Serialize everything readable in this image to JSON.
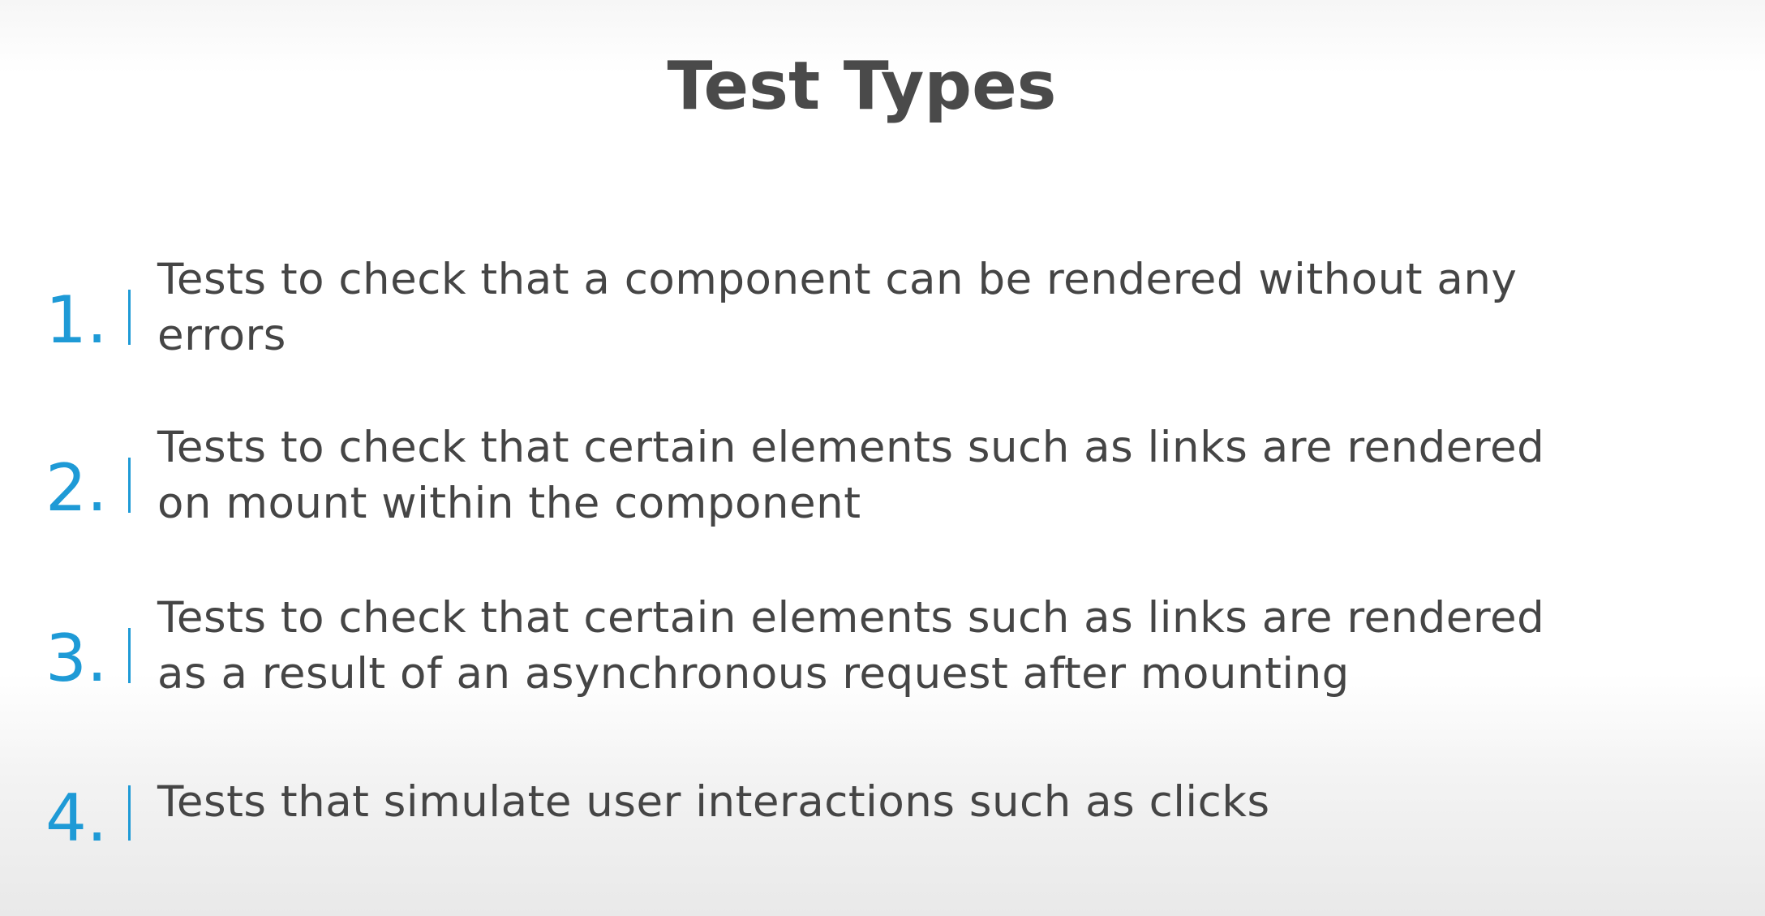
{
  "title": "Test Types",
  "items": [
    {
      "number": "1.",
      "line1": "Tests to check that a component can be rendered without any",
      "line2": "errors"
    },
    {
      "number": "2.",
      "line1": "Tests to check that certain elements such as links are rendered",
      "line2": "on mount within the component"
    },
    {
      "number": "3.",
      "line1": "Tests to check that certain elements such as links are rendered",
      "line2": "as a result of an asynchronous request after mounting"
    },
    {
      "number": "4.",
      "line1": "Tests that simulate user interactions such as clicks",
      "line2": ""
    }
  ],
  "colors": {
    "accent": "#1e9ad6",
    "text": "#454545",
    "title": "#4a4a4a"
  }
}
